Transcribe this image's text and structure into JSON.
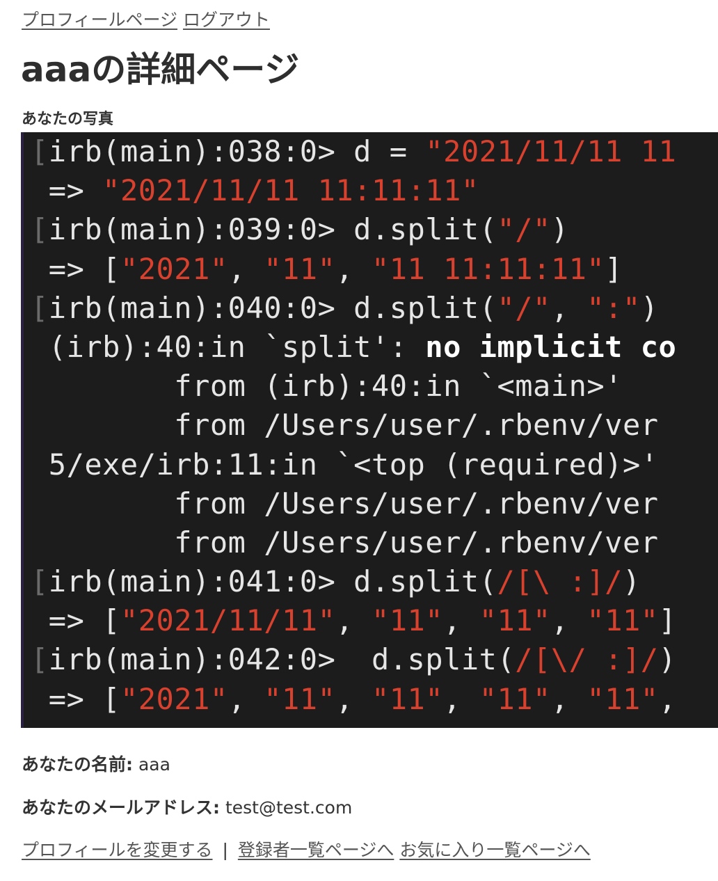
{
  "nav_top": {
    "profile_link": "プロフィールページ",
    "logout_link": "ログアウト"
  },
  "page_title": "aaaの詳細ページ",
  "photo_label": "あなたの写真",
  "terminal_lines": [
    [
      {
        "t": "[",
        "c": "br"
      },
      {
        "t": "irb(main):038:0> d = "
      },
      {
        "t": "\"2021/11/11 11",
        "c": "r"
      }
    ],
    [
      {
        "t": " => "
      },
      {
        "t": "\"2021/11/11 11:11:11\"",
        "c": "r"
      }
    ],
    [
      {
        "t": "[",
        "c": "br"
      },
      {
        "t": "irb(main):039:0> d.split("
      },
      {
        "t": "\"/\"",
        "c": "r"
      },
      {
        "t": ")"
      }
    ],
    [
      {
        "t": " => ["
      },
      {
        "t": "\"2021\"",
        "c": "r"
      },
      {
        "t": ", "
      },
      {
        "t": "\"11\"",
        "c": "r"
      },
      {
        "t": ", "
      },
      {
        "t": "\"11 11:11:11\"",
        "c": "r"
      },
      {
        "t": "]"
      }
    ],
    [
      {
        "t": "[",
        "c": "br"
      },
      {
        "t": "irb(main):040:0> d.split("
      },
      {
        "t": "\"/\"",
        "c": "r"
      },
      {
        "t": ", "
      },
      {
        "t": "\":\"",
        "c": "r"
      },
      {
        "t": ")"
      }
    ],
    [
      {
        "t": " (irb):40:in `split': "
      },
      {
        "t": "no implicit co",
        "c": "b"
      }
    ],
    [
      {
        "t": "        from (irb):40:in `<main>'"
      }
    ],
    [
      {
        "t": "        from /Users/user/.rbenv/ver"
      }
    ],
    [
      {
        "t": " 5/exe/irb:11:in `<top (required)>'"
      }
    ],
    [
      {
        "t": "        from /Users/user/.rbenv/ver"
      }
    ],
    [
      {
        "t": "        from /Users/user/.rbenv/ver"
      }
    ],
    [
      {
        "t": "[",
        "c": "br"
      },
      {
        "t": "irb(main):041:0> d.split("
      },
      {
        "t": "/[\\ :]/",
        "c": "r"
      },
      {
        "t": ")"
      }
    ],
    [
      {
        "t": " => ["
      },
      {
        "t": "\"2021/11/11\"",
        "c": "r"
      },
      {
        "t": ", "
      },
      {
        "t": "\"11\"",
        "c": "r"
      },
      {
        "t": ", "
      },
      {
        "t": "\"11\"",
        "c": "r"
      },
      {
        "t": ", "
      },
      {
        "t": "\"11\"",
        "c": "r"
      },
      {
        "t": "]"
      }
    ],
    [
      {
        "t": "[",
        "c": "br"
      },
      {
        "t": "irb(main):042:0>  d.split("
      },
      {
        "t": "/[\\/ :]/",
        "c": "r"
      },
      {
        "t": ")"
      }
    ],
    [
      {
        "t": " => ["
      },
      {
        "t": "\"2021\"",
        "c": "r"
      },
      {
        "t": ", "
      },
      {
        "t": "\"11\"",
        "c": "r"
      },
      {
        "t": ", "
      },
      {
        "t": "\"11\"",
        "c": "r"
      },
      {
        "t": ", "
      },
      {
        "t": "\"11\"",
        "c": "r"
      },
      {
        "t": ", "
      },
      {
        "t": "\"11\"",
        "c": "r"
      },
      {
        "t": ","
      }
    ],
    [
      {
        "t": "                  ",
        "cursor": true
      }
    ]
  ],
  "name_row": {
    "label": "あなたの名前:",
    "value": "aaa"
  },
  "email_row": {
    "label": "あなたのメールアドレス:",
    "value": "test@test.com"
  },
  "nav_bottom": {
    "edit_profile_link": "プロフィールを変更する",
    "separator": "|",
    "user_list_link": "登録者一覧ページへ",
    "favorites_link": "お気に入り一覧ページへ"
  },
  "colors": {
    "terminal_bg": "#1c1c1c",
    "terminal_string": "#d9412f",
    "terminal_text": "#e6e6e6",
    "link": "#555555"
  }
}
